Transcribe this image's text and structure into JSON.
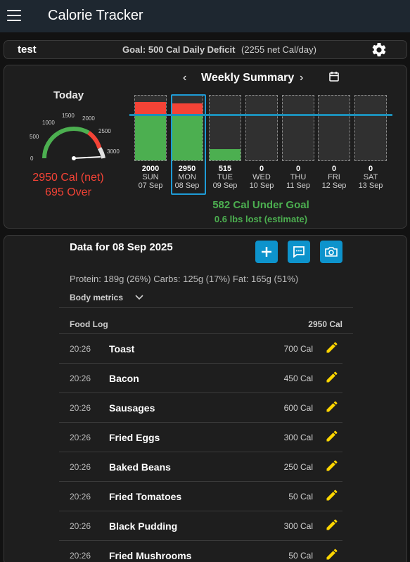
{
  "app": {
    "title": "Calorie Tracker"
  },
  "user": {
    "name": "test",
    "goal": "Goal: 500 Cal Daily Deficit",
    "goal_detail": "(2255 net Cal/day)"
  },
  "today": {
    "label": "Today",
    "gauge": {
      "ticks": [
        "0",
        "500",
        "1000",
        "1500",
        "2000",
        "2500",
        "3000"
      ],
      "max": 3000,
      "value": 2950
    },
    "net": "2950 Cal (net)",
    "over": "695 Over"
  },
  "weekly": {
    "title": "Weekly Summary",
    "prev_icon": "chevron-left-icon",
    "next_icon": "chevron-right-icon",
    "calendar_icon": "calendar-icon",
    "days": [
      {
        "value": "2000",
        "name": "SUN",
        "date": "07 Sep",
        "green": 0.68,
        "red": 0.22
      },
      {
        "value": "2950",
        "name": "MON",
        "date": "08 Sep",
        "green": 0.68,
        "red": 0.2,
        "selected": true
      },
      {
        "value": "515",
        "name": "TUE",
        "date": "09 Sep",
        "green": 0.17,
        "red": 0
      },
      {
        "value": "0",
        "name": "WED",
        "date": "10 Sep",
        "green": 0,
        "red": 0
      },
      {
        "value": "0",
        "name": "THU",
        "date": "11 Sep",
        "green": 0,
        "red": 0
      },
      {
        "value": "0",
        "name": "FRI",
        "date": "12 Sep",
        "green": 0,
        "red": 0
      },
      {
        "value": "0",
        "name": "SAT",
        "date": "13 Sep",
        "green": 0,
        "red": 0
      }
    ],
    "under_goal": "582 Cal Under Goal",
    "lbs_lost": "0.6 lbs lost (estimate)"
  },
  "day_data": {
    "title": "Data for 08 Sep 2025",
    "macros": "Protein: 189g (26%)   Carbs: 125g (17%)   Fat: 165g (51%)",
    "body_metrics": "Body metrics",
    "food_log_label": "Food Log",
    "food_log_total": "2950 Cal",
    "foods": [
      {
        "time": "20:26",
        "name": "Toast",
        "cal": "700 Cal"
      },
      {
        "time": "20:26",
        "name": "Bacon",
        "cal": "450 Cal"
      },
      {
        "time": "20:26",
        "name": "Sausages",
        "cal": "600 Cal"
      },
      {
        "time": "20:26",
        "name": "Fried Eggs",
        "cal": "300 Cal"
      },
      {
        "time": "20:26",
        "name": "Baked Beans",
        "cal": "250 Cal"
      },
      {
        "time": "20:26",
        "name": "Fried Tomatoes",
        "cal": "50 Cal"
      },
      {
        "time": "20:26",
        "name": "Black Pudding",
        "cal": "300 Cal"
      },
      {
        "time": "20:26",
        "name": "Fried Mushrooms",
        "cal": "50 Cal"
      }
    ]
  },
  "colors": {
    "accent": "#0d93cc",
    "over": "#f44336",
    "under": "#4caf50",
    "topbar": "#1e2730",
    "edit": "#ffd600"
  }
}
